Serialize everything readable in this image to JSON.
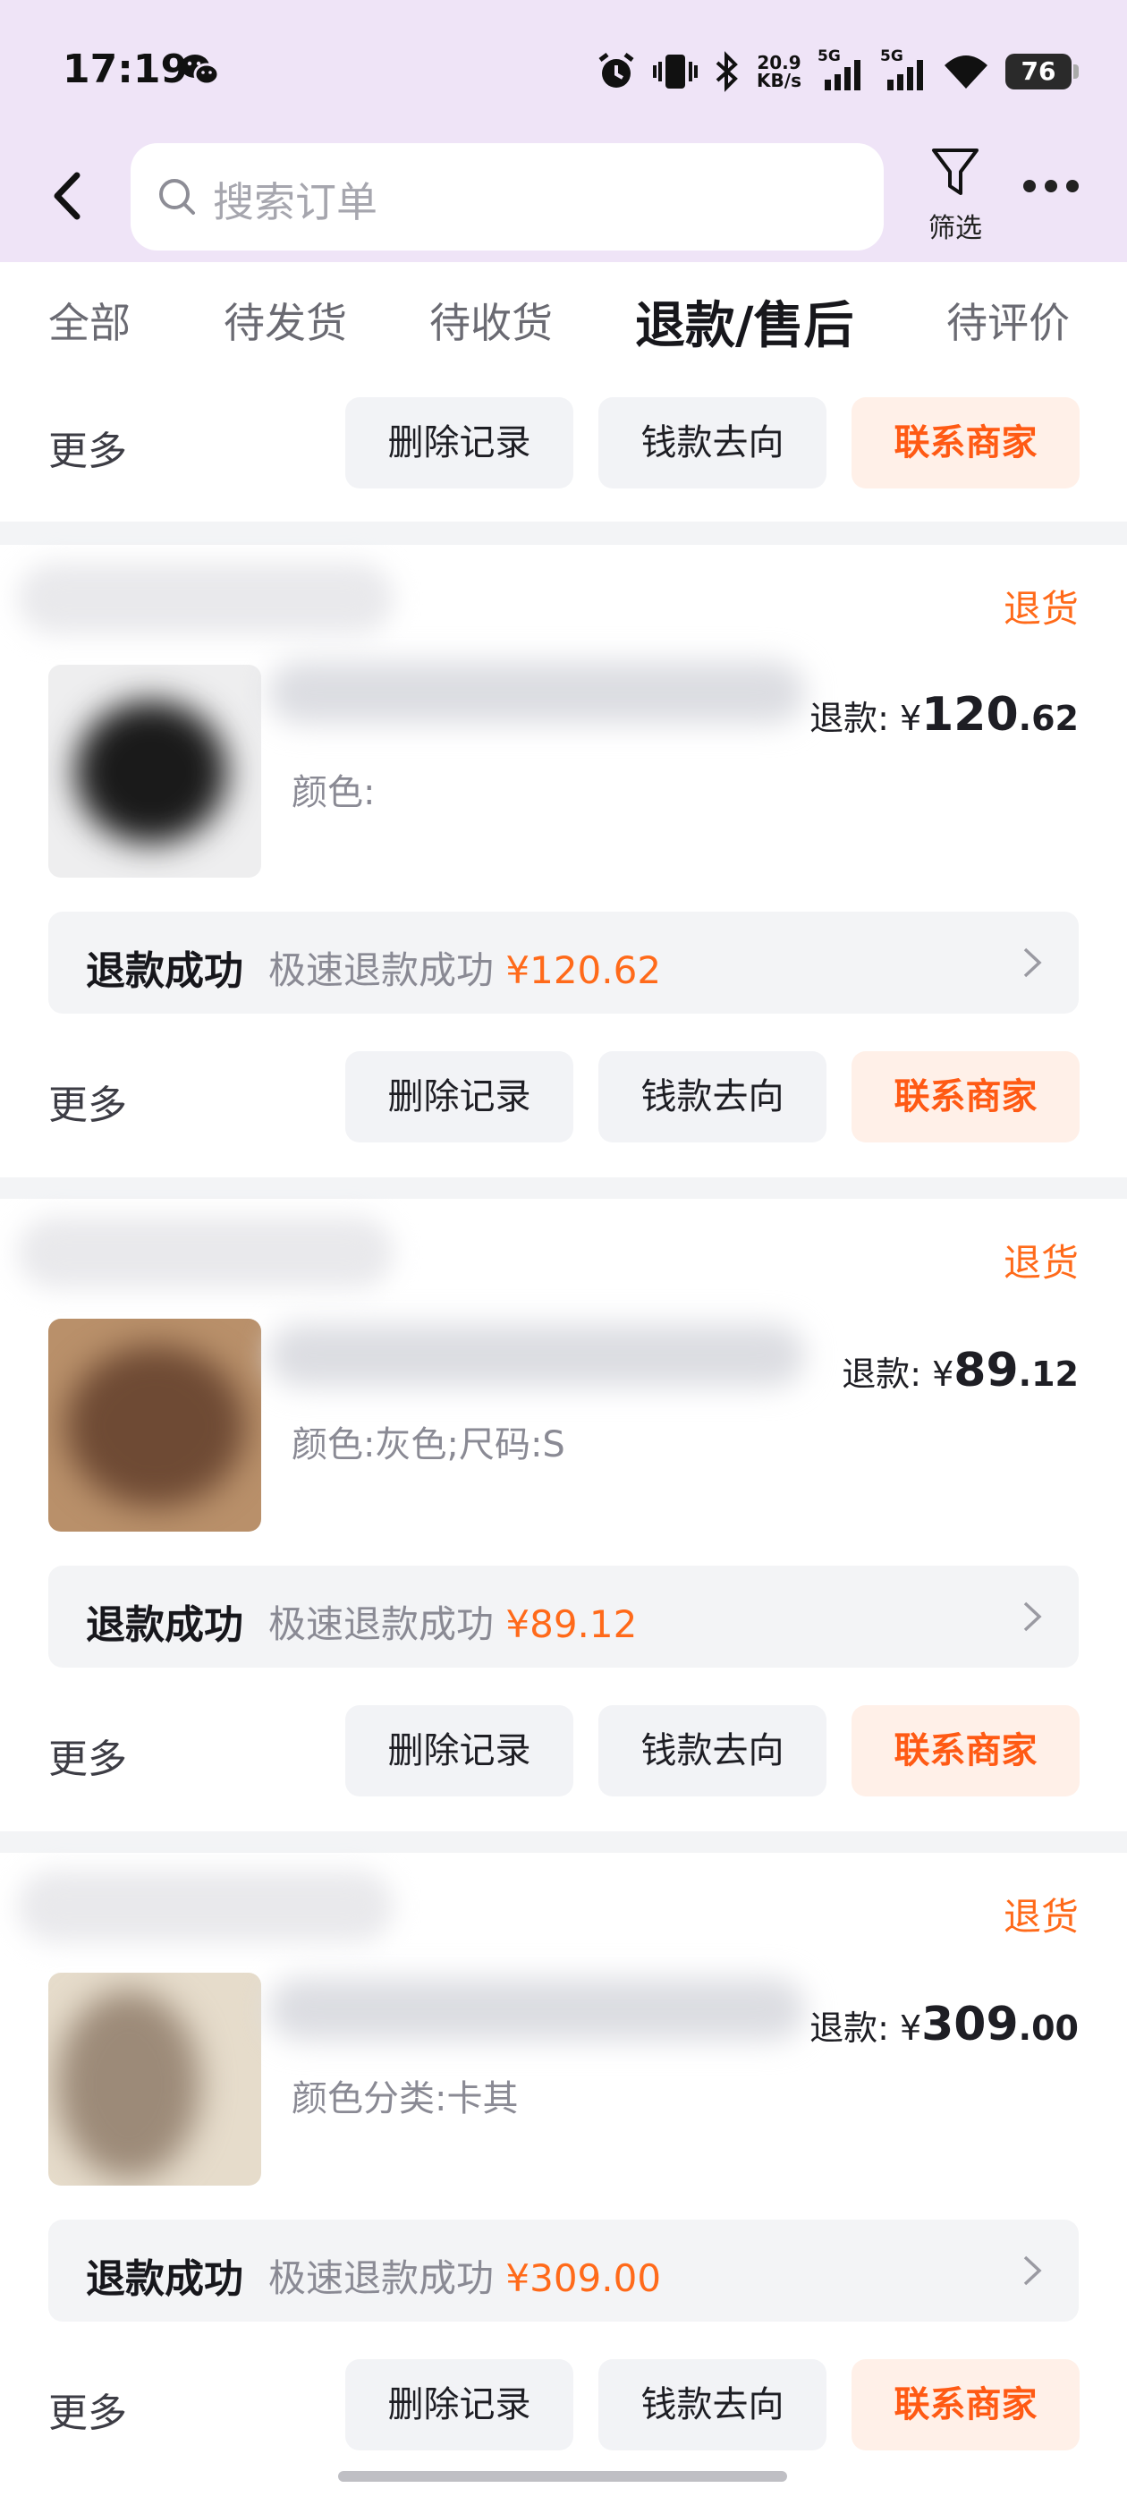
{
  "status_bar": {
    "time": "17:19",
    "net_speed_value": "20.9",
    "net_speed_unit": "KB/s",
    "sim1": "5G",
    "sim2": "5G",
    "battery": "76",
    "icons": [
      "wechat-icon",
      "alarm-icon",
      "vibrate-icon",
      "bluetooth-icon",
      "signal-icon",
      "wifi-icon",
      "battery-icon"
    ]
  },
  "header": {
    "search_placeholder": "搜索订单",
    "filter_label": "筛选"
  },
  "tabs": [
    {
      "label": "全部",
      "active": false
    },
    {
      "label": "待发货",
      "active": false
    },
    {
      "label": "待收货",
      "active": false
    },
    {
      "label": "退款/售后",
      "active": true
    },
    {
      "label": "待评价",
      "active": false
    }
  ],
  "actions": {
    "more": "更多",
    "delete": "删除记录",
    "money_flow": "钱款去向",
    "contact": "联系商家"
  },
  "orders": [
    {
      "type": "退货",
      "refund_label": "退款: ¥",
      "refund_int": "120",
      "refund_dec": ".62",
      "spec": "颜色:",
      "status_title": "退款成功",
      "status_desc": "极速退款成功",
      "status_amount": "¥120.62"
    },
    {
      "type": "退货",
      "refund_label": "退款: ¥",
      "refund_int": "89",
      "refund_dec": ".12",
      "spec": "颜色:灰色;尺码:S",
      "status_title": "退款成功",
      "status_desc": "极速退款成功",
      "status_amount": "¥89.12"
    },
    {
      "type": "退货",
      "refund_label": "退款: ¥",
      "refund_int": "309",
      "refund_dec": ".00",
      "spec": "颜色分类:卡其",
      "status_title": "退款成功",
      "status_desc": "极速退款成功",
      "status_amount": "¥309.00"
    }
  ],
  "colors": {
    "accent": "#ff6a1a",
    "header_bg": "#efe4f7",
    "contact_bg": "#fff0e8"
  }
}
